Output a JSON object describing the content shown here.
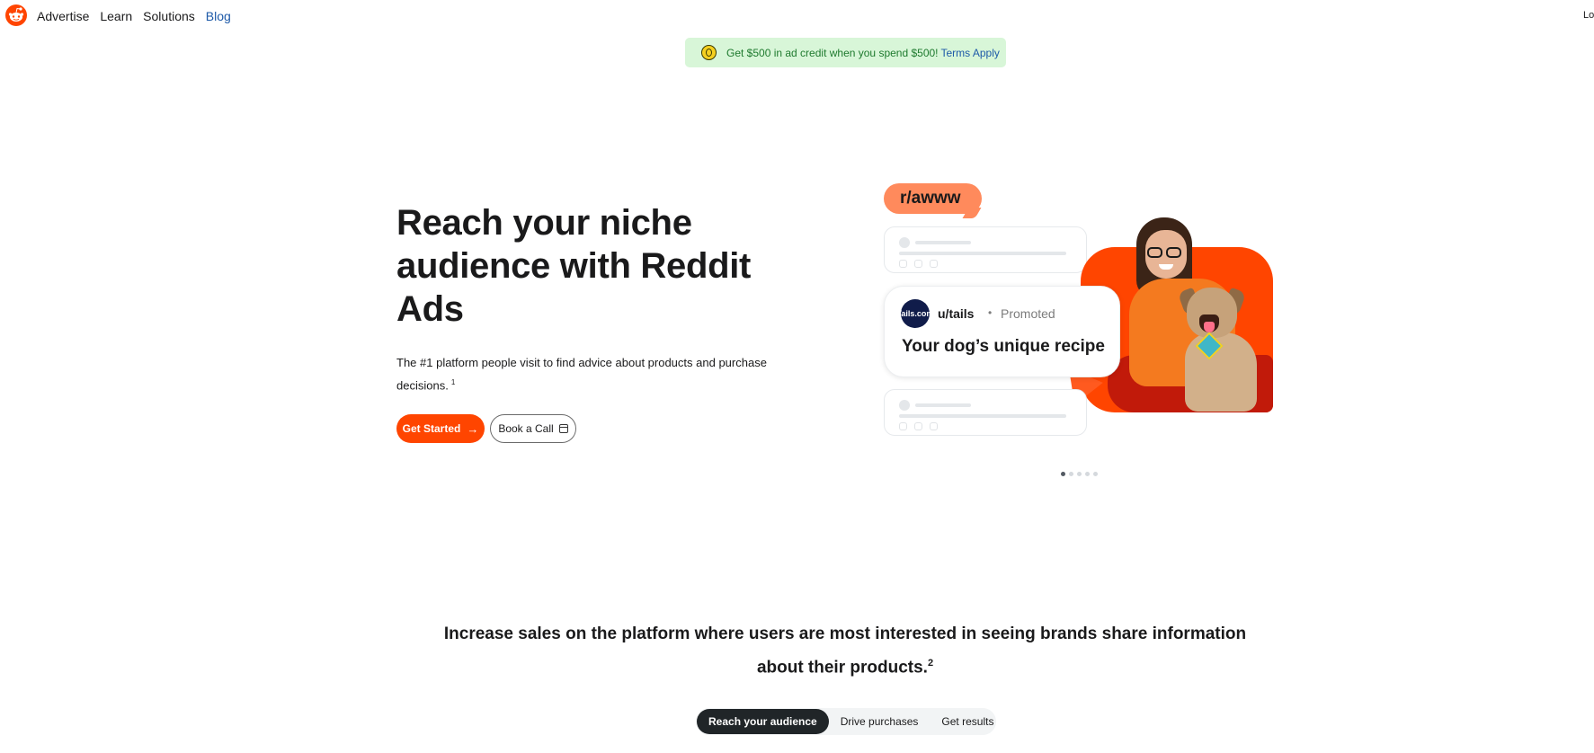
{
  "nav": {
    "logo_icon": "reddit-snoo-icon",
    "links": [
      {
        "label": "Advertise"
      },
      {
        "label": "Learn"
      },
      {
        "label": "Solutions"
      },
      {
        "label": "Blog"
      }
    ],
    "login_label": "Lo"
  },
  "promo": {
    "icon": "coin-icon",
    "text": "Get $500 in ad credit when you spend $500!",
    "link": "Terms Apply"
  },
  "hero": {
    "title": "Reach your niche audience with Reddit Ads",
    "subtitle": "The #1 platform people visit to find advice about products and purchase decisions.",
    "subtitle_footnote": "1",
    "primary_cta": "Get Started",
    "secondary_cta": "Book a Call"
  },
  "illustration": {
    "subreddit": "r/awww",
    "avatar_text": "Tails.com",
    "user": "u/tails",
    "separator": "•",
    "promoted": "Promoted",
    "headline": "Your dog’s unique recipe"
  },
  "carousel": {
    "count": 5,
    "active_index": 0
  },
  "section": {
    "heading": "Increase sales on the platform where users are most interested in seeing brands share information about their products.",
    "footnote": "2",
    "tabs": [
      {
        "label": "Reach your audience"
      },
      {
        "label": "Drive purchases"
      },
      {
        "label": "Get results"
      }
    ],
    "active_tab": 0
  },
  "colors": {
    "accent": "#ff4500",
    "link": "#1e5aa8",
    "promo_bg": "#d8f6d8",
    "promo_text": "#1e7a2e"
  }
}
